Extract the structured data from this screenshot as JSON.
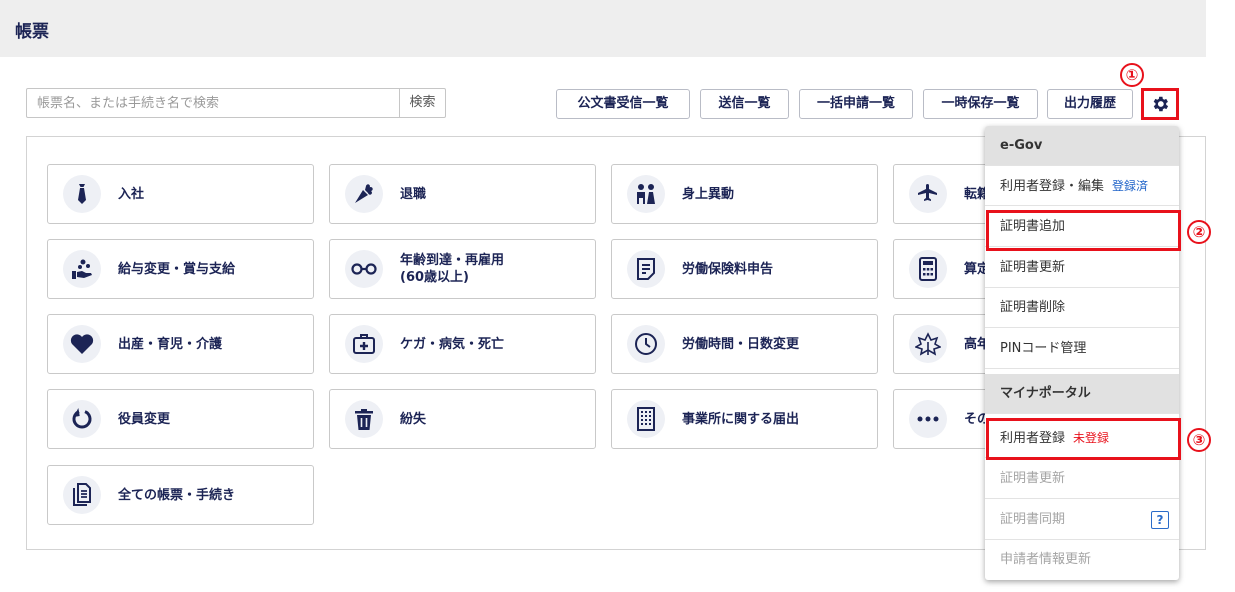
{
  "header": {
    "title": "帳票"
  },
  "search": {
    "placeholder": "帳票名、または手続き名で検索",
    "button": "検索"
  },
  "toolbar": {
    "buttons": [
      "公文書受信一覧",
      "送信一覧",
      "一括申請一覧",
      "一時保存一覧",
      "出力履歴"
    ],
    "settings_icon": "gear-icon"
  },
  "cards": [
    {
      "label": "入社",
      "icon": "necktie-icon"
    },
    {
      "label": "退職",
      "icon": "bouquet-icon"
    },
    {
      "label": "身上異動",
      "icon": "wedding-icon"
    },
    {
      "label": "転籍",
      "icon": "airplane-icon"
    },
    {
      "label": "給与変更・賞与支給",
      "icon": "coins-hand-icon"
    },
    {
      "label": "年齢到達・再雇用",
      "label2": "(60歳以上)",
      "icon": "glasses-icon"
    },
    {
      "label": "労働保険料申告",
      "icon": "document-icon"
    },
    {
      "label": "算定",
      "icon": "calculator-icon"
    },
    {
      "label": "出産・育児・介護",
      "icon": "heart-icon"
    },
    {
      "label": "ケガ・病気・死亡",
      "icon": "first-aid-icon"
    },
    {
      "label": "労働時間・日数変更",
      "icon": "clock-icon"
    },
    {
      "label": "高年",
      "icon": "leaf-icon"
    },
    {
      "label": "役員変更",
      "icon": "refresh-icon"
    },
    {
      "label": "紛失",
      "icon": "trash-icon"
    },
    {
      "label": "事業所に関する届出",
      "icon": "building-icon"
    },
    {
      "label": "その",
      "icon": "more-icon"
    },
    {
      "label": "全ての帳票・手続き",
      "icon": "documents-icon"
    }
  ],
  "menu": {
    "egov_header": "e-Gov",
    "user_reg": "利用者登録・編集",
    "user_reg_status": "登録済",
    "cert_add": "証明書追加",
    "cert_update": "証明書更新",
    "cert_delete": "証明書削除",
    "pin_manage": "PINコード管理",
    "myna_header": "マイナポータル",
    "myna_user_reg": "利用者登録",
    "myna_user_status": "未登録",
    "myna_cert_update": "証明書更新",
    "myna_cert_sync": "証明書同期",
    "myna_help": "?",
    "myna_applicant_update": "申請者情報更新"
  },
  "annotations": {
    "one": "①",
    "two": "②",
    "three": "③"
  },
  "colors": {
    "brand": "#1c2455",
    "highlight": "#e8111b",
    "link": "#1e62c8"
  }
}
